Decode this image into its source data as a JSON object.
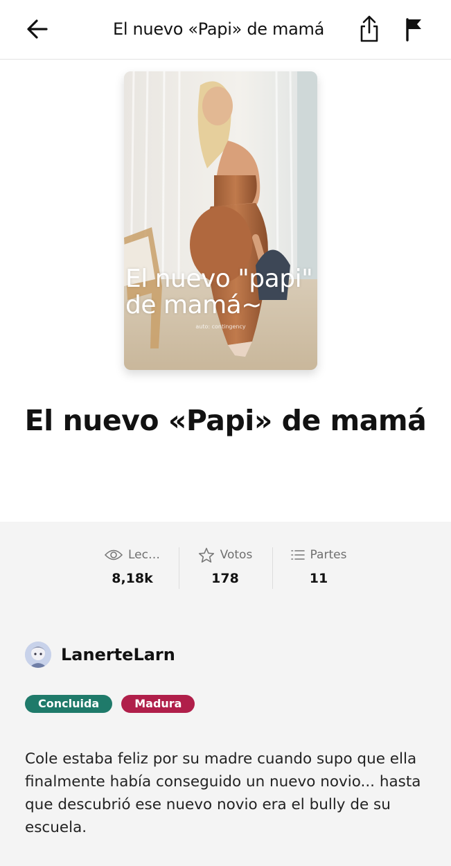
{
  "header": {
    "title": "El nuevo «Papi» de mamá"
  },
  "icons": {
    "back": "arrow-left-icon",
    "share": "share-icon",
    "report": "flag-icon"
  },
  "cover": {
    "overlay_text": "El nuevo \"papi\"\nde mamá~",
    "watermark": "auto: contingency"
  },
  "story": {
    "title": "El nuevo «Papi» de mamá"
  },
  "stats": [
    {
      "icon": "eye-icon",
      "label": "Lec…",
      "value": "8,18k"
    },
    {
      "icon": "star-icon",
      "label": "Votos",
      "value": "178"
    },
    {
      "icon": "list-icon",
      "label": "Partes",
      "value": "11"
    }
  ],
  "author": {
    "name": "LanerteLarn"
  },
  "tags": [
    {
      "label": "Concluida",
      "color": "#1f7a6a"
    },
    {
      "label": "Madura",
      "color": "#b01f4a"
    }
  ],
  "description": "Cole estaba feliz por su madre cuando supo que ella finalmente había conseguido un nuevo novio... hasta que descubrió ese nuevo novio era el bully de su escuela."
}
